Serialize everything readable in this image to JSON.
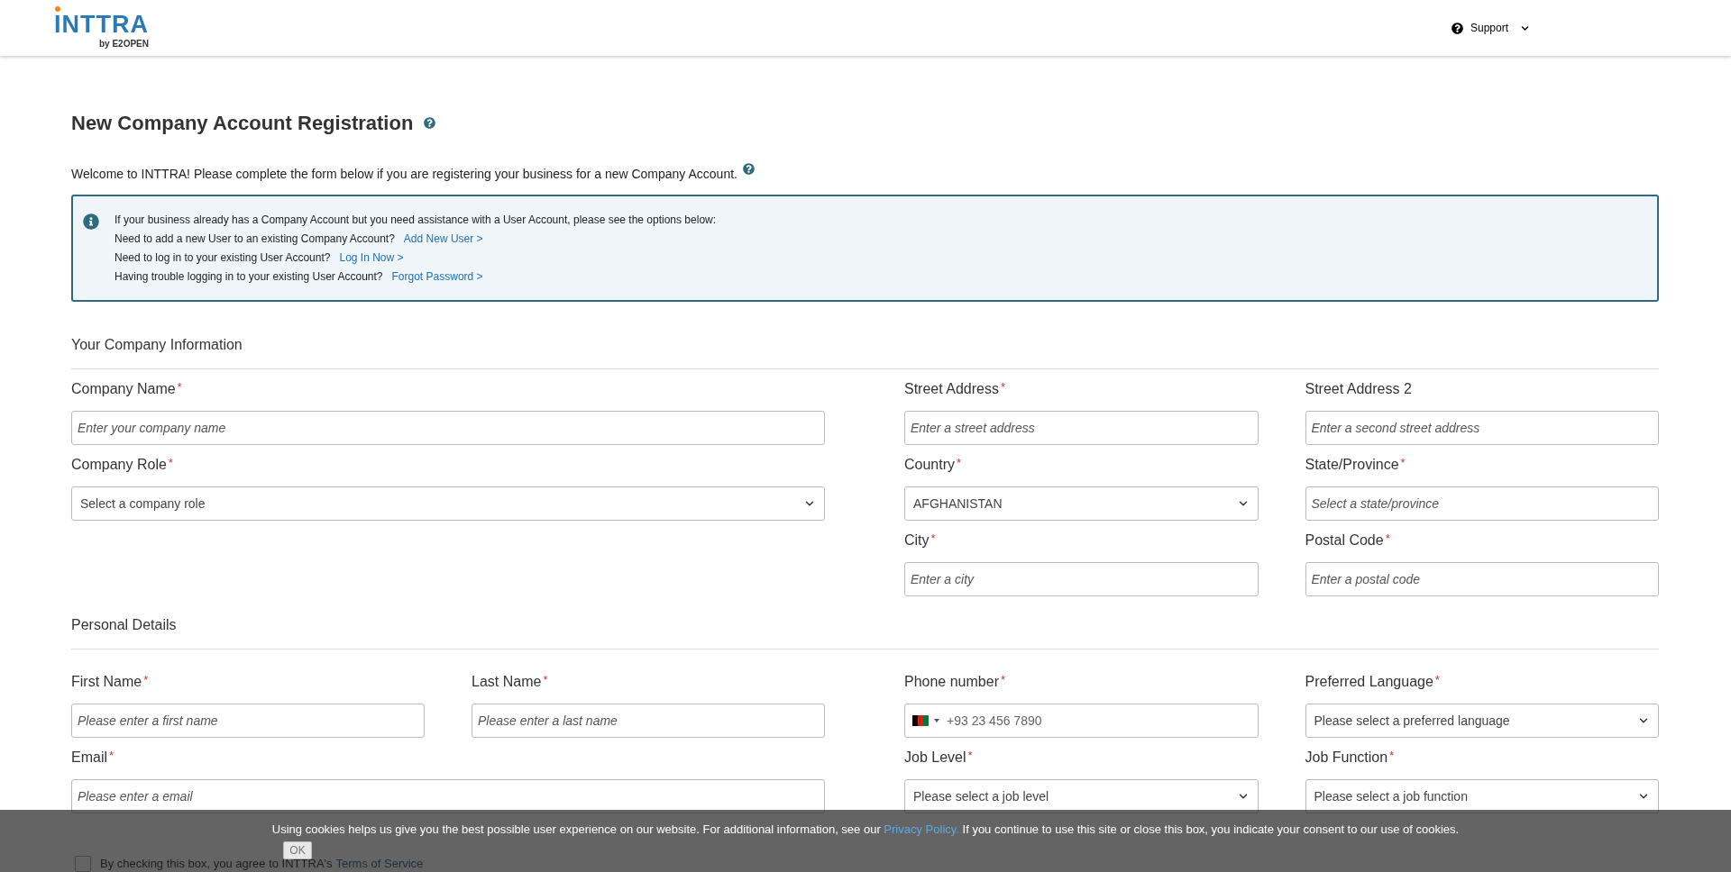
{
  "header": {
    "logo": {
      "name": "INTTRA",
      "byline": "by E2OPEN"
    },
    "support": "Support"
  },
  "title": "New Company Account Registration",
  "welcome": "Welcome to INTTRA! Please complete the form below if you are registering your business for a new Company Account.",
  "info": {
    "intro": "If your business already has a Company Account but you need assistance with a User Account, please see the options below:",
    "lines": [
      {
        "text": "Need to add a new User to an existing Company Account?",
        "link": "Add New User >"
      },
      {
        "text": "Need to log in to your existing User Account?",
        "link": "Log In Now >"
      },
      {
        "text": "Having trouble logging in to your existing User Account?",
        "link": "Forgot Password >"
      }
    ]
  },
  "sections": [
    {
      "title": "Your Company Information",
      "rows": [
        {
          "left": [
            {
              "label": "Company Name",
              "marker": "*",
              "kind": "text",
              "placeholder": "Enter your company name"
            }
          ],
          "right": [
            {
              "label": "Street Address",
              "marker": "*",
              "kind": "text",
              "placeholder": "Enter a street address"
            },
            {
              "label": "Street Address 2",
              "kind": "text",
              "placeholder": "Enter a second street address"
            }
          ]
        },
        {
          "left": [
            {
              "label": "Company Role",
              "marker": "*",
              "kind": "select",
              "value": "Select a company role"
            }
          ],
          "right": [
            {
              "label": "Country",
              "marker": "*",
              "kind": "select",
              "value": "AFGHANISTAN"
            },
            {
              "label": "State/Province",
              "marker": "*",
              "kind": "text",
              "placeholder": "Select a state/province"
            }
          ]
        },
        {
          "right": [
            {
              "label": "City",
              "marker": "*",
              "kind": "text",
              "placeholder": "Enter a city"
            },
            {
              "label": "Postal Code",
              "marker": "*",
              "kind": "text",
              "placeholder": "Enter a postal code"
            }
          ]
        }
      ]
    },
    {
      "title": "Personal Details",
      "rows": [
        {
          "left": [
            {
              "label": "First Name",
              "marker": "*",
              "kind": "text",
              "placeholder": "Please enter a first name"
            },
            {
              "label": "Last Name",
              "marker": "*",
              "kind": "text",
              "placeholder": "Please enter a last name"
            }
          ],
          "right": [
            {
              "label": "Phone number",
              "marker": "*",
              "kind": "phone",
              "placeholder": "+93 23 456 7890"
            },
            {
              "label": "Preferred Language",
              "marker": "*",
              "kind": "select",
              "value": "Please select a preferred language"
            }
          ]
        },
        {
          "left": [
            {
              "label": "Email",
              "marker": "*",
              "kind": "text",
              "placeholder": "Please enter a email"
            }
          ],
          "right": [
            {
              "label": "Job Level",
              "marker": "*",
              "kind": "select",
              "value": "Please select a job level"
            },
            {
              "label": "Job Function",
              "marker": "*",
              "kind": "select",
              "value": "Please select a job function"
            }
          ]
        }
      ]
    }
  ],
  "terms": {
    "checked": false,
    "text": "By checking this box, you agree to INTTRA's",
    "link": "Terms of Service"
  },
  "cookie": {
    "text_before": "Using cookies helps us give you the best possible user experience on our website. For additional information, see our",
    "link": "Privacy Policy.",
    "text_after": "If you continue to use this site or close this box, you indicate your consent to our use of cookies.",
    "button": "OK"
  }
}
